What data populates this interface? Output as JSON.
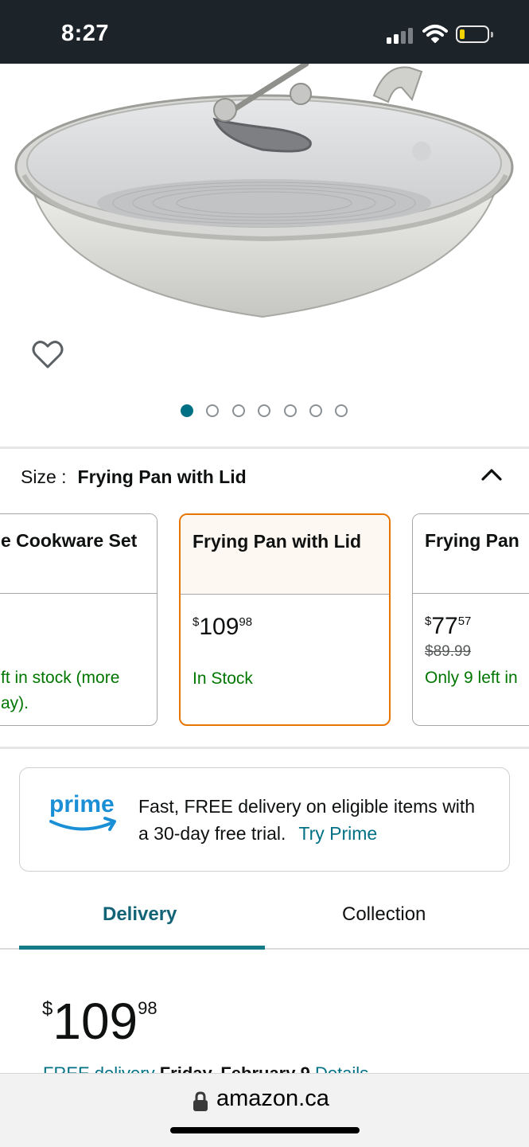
{
  "status_bar": {
    "time": "8:27",
    "battery_level_percent": 15
  },
  "product": {
    "image_icon": "frying-pan-with-glass-lid-image",
    "image_count": 7,
    "active_image_index": 0
  },
  "size": {
    "label": "Size :",
    "selected": "Frying Pan with Lid",
    "options": [
      {
        "title": "e Cookware Set",
        "stock": "ft in stock (more",
        "stock_line2": "ay)."
      },
      {
        "title": "Frying Pan with Lid",
        "price_currency": "$",
        "price_whole": "109",
        "price_fraction": "98",
        "stock": "In Stock"
      },
      {
        "title": "Frying Pan",
        "price_currency": "$",
        "price_whole": "77",
        "price_fraction": "57",
        "list_price": "$89.99",
        "stock": "Only 9 left in"
      }
    ]
  },
  "prime": {
    "logo_text": "prime",
    "text": "Fast, FREE delivery on eligible items with a 30-day free trial.",
    "link": "Try Prime"
  },
  "tabs": [
    {
      "label": "Delivery",
      "active": true
    },
    {
      "label": "Collection",
      "active": false
    }
  ],
  "buybox": {
    "price_currency": "$",
    "price_whole": "109",
    "price_fraction": "98",
    "delivery_link": "FREE delivery",
    "delivery_date": "Friday, February 9",
    "details_link": "Details"
  },
  "browser": {
    "url": "amazon.ca"
  },
  "colors": {
    "accent_teal": "#007185",
    "selected_border": "#e77600",
    "in_stock": "#007600",
    "status_bar_bg": "#1c2329"
  }
}
